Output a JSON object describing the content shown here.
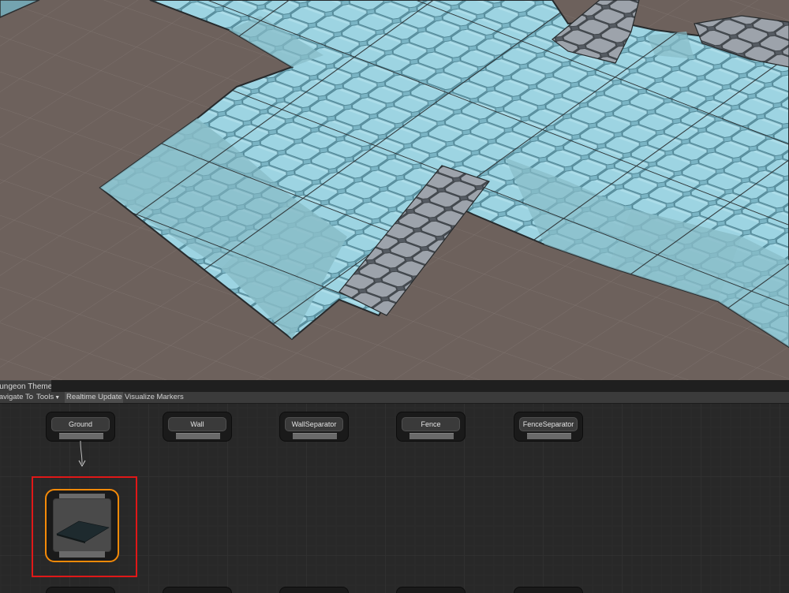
{
  "panel": {
    "tab_title": "Dungeon Theme",
    "toolbar": {
      "navigate_label": "Navigate To",
      "tools_label": "Tools",
      "realtime_label": "Realtime Update",
      "visualize_label": "Visualize Markers"
    }
  },
  "nodes": [
    {
      "label": "Ground"
    },
    {
      "label": "Wall"
    },
    {
      "label": "WallSeparator"
    },
    {
      "label": "Fence"
    },
    {
      "label": "FenceSeparator"
    }
  ],
  "colors": {
    "ground": "#6d615c",
    "floor_tint": "#77b2c2",
    "stone_gray": "#8f949c",
    "selection": "#e01818",
    "node_highlight": "#f58a08"
  },
  "icons": {
    "dropdown": "triangle-down",
    "link_arrow": "arrow-down"
  }
}
